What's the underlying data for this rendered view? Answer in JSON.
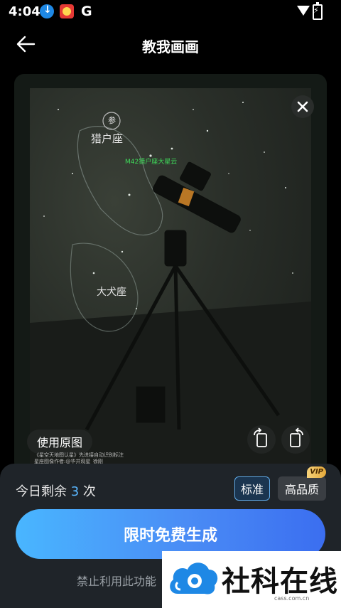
{
  "status_bar": {
    "time": "4:04",
    "g_letter": "G"
  },
  "header": {
    "title": "教我画画"
  },
  "image_card": {
    "use_original_label": "使用原图",
    "overlay_labels": {
      "constellation_1": "猎户座",
      "constellation_2": "大犬座",
      "circle_label": "参",
      "annotation_green": "M42猎户座大星云"
    },
    "credit_lines": [
      "《星空天地图认星》先进接自动识别标注",
      "星座图像作者:@华井观星_徐刚"
    ]
  },
  "panel": {
    "remaining_prefix": "今日剩余",
    "remaining_count": "3",
    "remaining_suffix": "次",
    "quality_standard": "标准",
    "quality_high": "高品质",
    "vip_badge": "VIP",
    "generate_label": "限时免费生成",
    "disclaimer": "禁止利用此功能"
  },
  "watermark": {
    "brand": "社科在线",
    "url": "cass.com.cn"
  },
  "colors": {
    "accent": "#5ab7ff",
    "button_start": "#49b6ff",
    "button_end": "#3b6ef0"
  }
}
